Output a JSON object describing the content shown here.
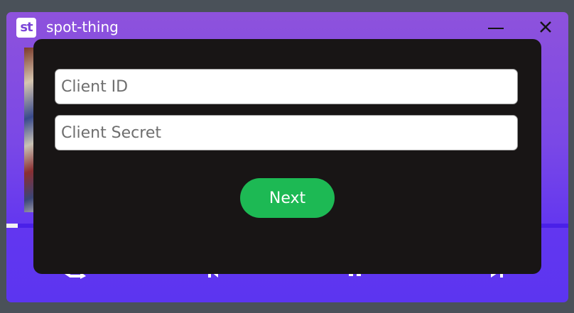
{
  "window": {
    "logo_text": "st",
    "title": "spot-thing",
    "icons": {
      "minimize": "minimize-icon",
      "close": "close-icon"
    }
  },
  "player": {
    "progress": 0.02
  },
  "auth_dialog": {
    "client_id": {
      "placeholder": "Client ID",
      "value": ""
    },
    "client_secret": {
      "placeholder": "Client Secret",
      "value": ""
    },
    "next_label": "Next"
  },
  "colors": {
    "accent_purple": "#6236f0",
    "dialog_bg": "#181515",
    "next_button": "#1db954"
  }
}
